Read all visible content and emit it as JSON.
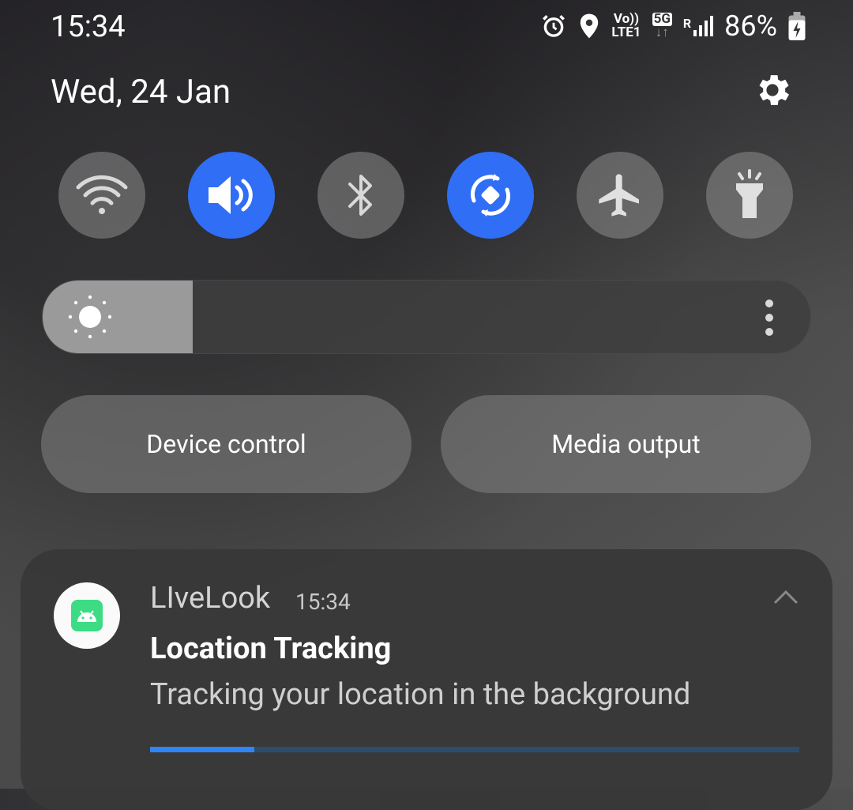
{
  "status_bar": {
    "time": "15:34",
    "net_top": "Vo))",
    "net_bottom": "LTE1",
    "net_5g": "5G",
    "roaming": "R",
    "battery": "86%"
  },
  "header": {
    "date": "Wed, 24 Jan"
  },
  "quick_settings": [
    {
      "name": "wifi",
      "icon": "wifi-icon",
      "state": "off"
    },
    {
      "name": "sound",
      "icon": "volume-icon",
      "state": "on"
    },
    {
      "name": "bluetooth",
      "icon": "bluetooth-icon",
      "state": "off"
    },
    {
      "name": "auto-rotate",
      "icon": "rotate-icon",
      "state": "on"
    },
    {
      "name": "airplane",
      "icon": "airplane-icon",
      "state": "off"
    },
    {
      "name": "flashlight",
      "icon": "flashlight-icon",
      "state": "off"
    }
  ],
  "brightness": {
    "level": 0.195
  },
  "buttons": {
    "device_control": "Device control",
    "media_output": "Media output"
  },
  "notification": {
    "app": "LIveLook",
    "time": "15:34",
    "title": "Location Tracking",
    "body": "Tracking your location in the background",
    "progress": 0.16
  },
  "colors": {
    "accent": "#2f6ef5",
    "progress": "#2f86f5"
  }
}
